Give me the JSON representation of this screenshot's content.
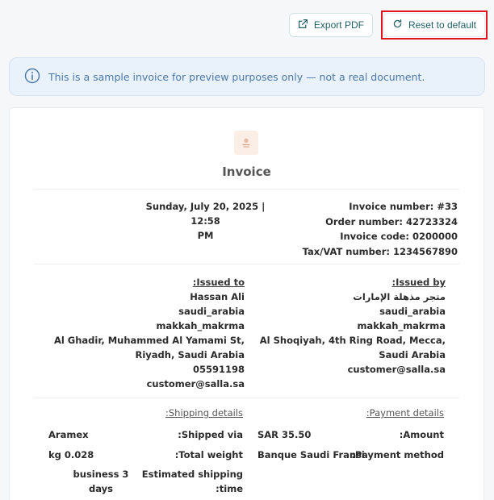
{
  "toolbar": {
    "export_label": "Export PDF",
    "reset_label": "Reset to default"
  },
  "banner": {
    "text": "This is a sample invoice for preview purposes only — not a real document."
  },
  "invoice": {
    "title": "Invoice",
    "datetime_line1": "Sunday, July 20, 2025 | 12:58",
    "datetime_line2": "PM",
    "invoice_number": "Invoice number: #33",
    "order_number": "Order number: 42723324",
    "invoice_code": "Invoice code: 0200000",
    "tax_number": "Tax/VAT number: 1234567890"
  },
  "issued_to": {
    "heading": ":Issued to",
    "name": "Hassan Ali",
    "country": "saudi_arabia",
    "city": "makkah_makrma",
    "address1": "Al Ghadir, Muhammed Al Yamami St,",
    "address2": "Riyadh, Saudi Arabia",
    "phone": "05591198",
    "email": "customer@salla.sa"
  },
  "issued_by": {
    "heading": ":Issued by",
    "name": "متجر مذهلة الإمارات",
    "country": "saudi_arabia",
    "city": "makkah_makrma",
    "address1": "Al Shoqiyah, 4th Ring Road, Mecca,",
    "address2": "Saudi Arabia",
    "email": "customer@salla.sa"
  },
  "shipping": {
    "heading": ":Shipping details",
    "shipped_via_label": ":Shipped via",
    "shipped_via_value": "Aramex",
    "weight_label": ":Total weight",
    "weight_value": "kg 0.028",
    "est_label_1": "Estimated shipping",
    "est_label_2": ":time",
    "est_value_1": "business 3",
    "est_value_2": "days"
  },
  "payment": {
    "heading": ":Payment details",
    "amount_label": ":Amount",
    "amount_value": "SAR 35.50",
    "method_label": ":Payment method",
    "method_value": "Banque Saudi Fransi"
  },
  "colors": {
    "accent": "#1f5f66",
    "highlight": "#e3151b",
    "banner_text": "#4c78a8"
  }
}
